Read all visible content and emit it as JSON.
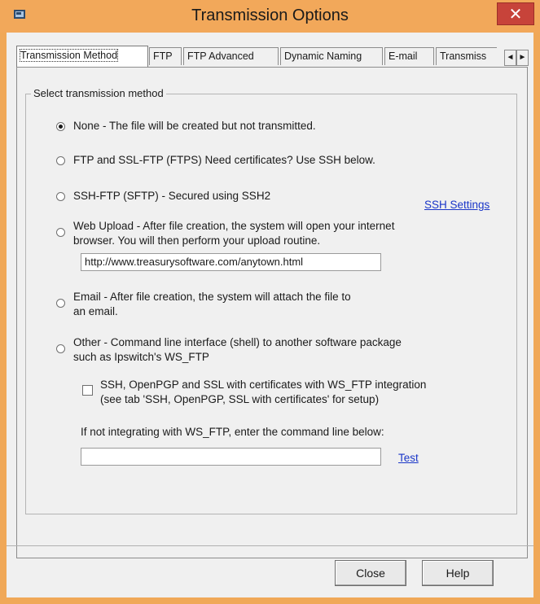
{
  "window": {
    "title": "Transmission Options",
    "close_glyph": "✕"
  },
  "tabs": [
    {
      "label": "Transmission Method",
      "active": true
    },
    {
      "label": "FTP"
    },
    {
      "label": "FTP Advanced"
    },
    {
      "label": "Dynamic Naming"
    },
    {
      "label": "E-mail"
    },
    {
      "label": "Transmiss"
    }
  ],
  "tab_scroll": {
    "left": "◄",
    "right": "►"
  },
  "group": {
    "legend": "Select transmission method"
  },
  "options": {
    "none": {
      "label": "None - The file will be created but not transmitted.",
      "checked": true
    },
    "ftp": {
      "label": "FTP and SSL-FTP (FTPS) Need certificates? Use SSH below."
    },
    "sftp": {
      "label": "SSH-FTP (SFTP) - Secured using SSH2"
    },
    "web": {
      "line1": "Web Upload - After file creation, the system will open your internet",
      "line2": "browser.  You will then perform your upload routine."
    },
    "email": {
      "line1": "Email - After file creation, the system will attach the file to",
      "line2": "an email."
    },
    "other": {
      "line1": "Other - Command line interface (shell) to another software package",
      "line2": "such as Ipswitch's WS_FTP"
    }
  },
  "ssh_settings_link": "SSH Settings",
  "web_url_value": "http://www.treasurysoftware.com/anytown.html",
  "ws_ftp_checkbox": {
    "line1": "SSH, OpenPGP and SSL with certificates with WS_FTP integration",
    "line2": "(see tab 'SSH, OpenPGP, SSL with certificates' for setup)",
    "checked": false
  },
  "command_line_label": "If not integrating with WS_FTP, enter the command line below:",
  "command_line_value": "",
  "test_link": "Test",
  "buttons": {
    "close": "Close",
    "help": "Help"
  }
}
